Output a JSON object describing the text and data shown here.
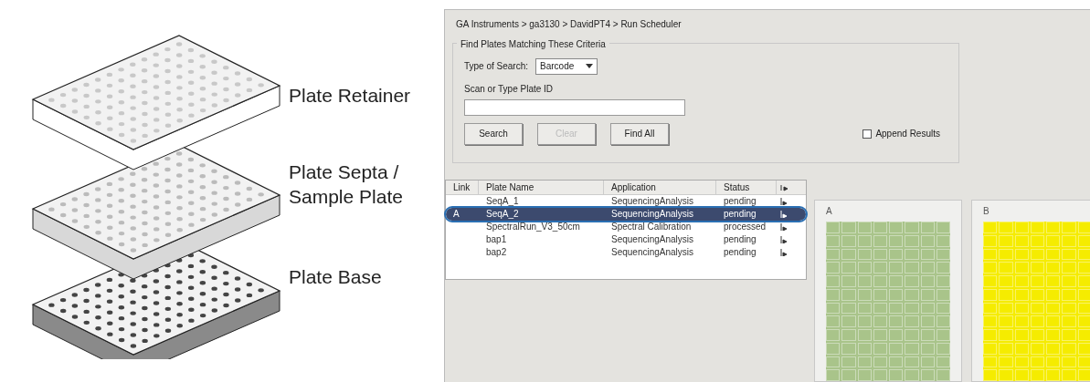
{
  "figure": {
    "labels": [
      "Plate Retainer",
      "Plate Septa / Sample Plate",
      "Plate Base"
    ]
  },
  "screen": {
    "breadcrumb": "GA Instruments > ga3130 > DavidPT4 > Run Scheduler",
    "criteria": {
      "title": "Find Plates Matching These Criteria",
      "search_type_label": "Type of Search:",
      "search_type": "Barcode",
      "plate_id_label": "Scan or Type Plate ID",
      "buttons": [
        {
          "label": "Search",
          "disabled": false
        },
        {
          "label": "Clear",
          "disabled": true
        },
        {
          "label": "Find All",
          "disabled": false
        }
      ],
      "append_results": {
        "label": "Append Results",
        "checked": false
      }
    },
    "table": {
      "columns": [
        "Link",
        "Plate Name",
        "Application",
        "Status"
      ],
      "rows": [
        {
          "link": "",
          "plate_name": "SeqA_1",
          "application": "SequencingAnalysis",
          "status": "pending",
          "selected": false
        },
        {
          "link": "A",
          "plate_name": "SeqA_2",
          "application": "SequencingAnalysis",
          "status": "pending",
          "selected": true
        },
        {
          "link": "",
          "plate_name": "SpectralRun_V3_50cm",
          "application": "Spectral Calibration",
          "status": "processed",
          "selected": false
        },
        {
          "link": "",
          "plate_name": "bap1",
          "application": "SequencingAnalysis",
          "status": "pending",
          "selected": false
        },
        {
          "link": "",
          "plate_name": "bap2",
          "application": "SequencingAnalysis",
          "status": "pending",
          "selected": false
        }
      ]
    },
    "plates": [
      {
        "label": "A",
        "color": "#a9c48a"
      },
      {
        "label": "B",
        "color": "#f5ec00"
      }
    ]
  }
}
